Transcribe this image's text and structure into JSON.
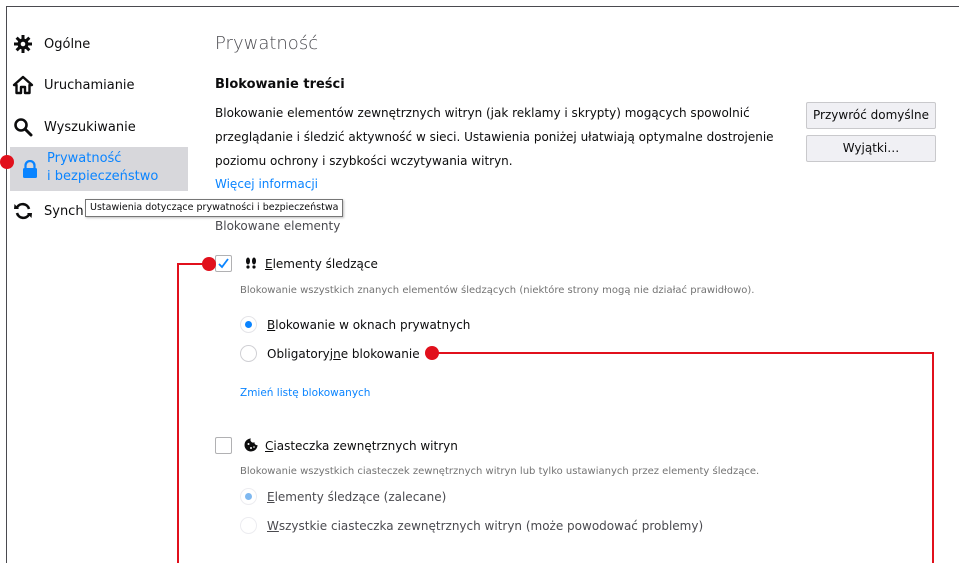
{
  "sidebar": {
    "items": [
      {
        "label": "Ogólne",
        "icon": "gear-icon"
      },
      {
        "label": "Uruchamianie",
        "icon": "home-icon"
      },
      {
        "label": "Wyszukiwanie",
        "icon": "search-icon"
      },
      {
        "label_line1": "Prywatność",
        "label_line2": "i bezpieczeństwo",
        "icon": "lock-icon",
        "active": true
      },
      {
        "label": "Synch",
        "icon": "sync-icon"
      }
    ],
    "tooltip": "Ustawienia dotyczące prywatności i bezpieczeństwa"
  },
  "main": {
    "title": "Prywatność",
    "section_title": "Blokowanie treści",
    "description_1": "Blokowanie elementów zewnętrznych witryn (jak reklamy i skrypty) mogących spowolnić",
    "description_2": "przeglądanie i śledzić aktywność w sieci. Ustawienia poniżej ułatwiają optymalne dostrojenie",
    "description_3": "poziomu ochrony i szybkości wczytywania witryn.",
    "more_info_link": "Więcej informacji",
    "restore_defaults_button": "Przywróć domyślne",
    "exceptions_button": "Wyjątki…",
    "blocked_heading": "Blokowane elementy",
    "trackers": {
      "checked": true,
      "label_prefix": "E",
      "label_rest": "lementy śledzące",
      "description": "Blokowanie wszystkich znanych elementów śledzących (niektóre strony mogą nie działać prawidłowo).",
      "options": [
        {
          "prefix": "B",
          "rest": "lokowanie w oknach prywatnych",
          "selected": true
        },
        {
          "before": "Obligatoryj",
          "u": "n",
          "after": "e blokowanie",
          "selected": false
        }
      ],
      "change_list_link": "Zmień listę blokowanych"
    },
    "cookies": {
      "checked": false,
      "label_prefix": "C",
      "label_rest": "iasteczka zewnętrznych witryn",
      "description": "Blokowanie wszystkich ciasteczek zewnętrznych witryn lub tylko ustawianych przez elementy śledzące.",
      "options": [
        {
          "prefix": "E",
          "rest": "lementy śledzące (zalecane)",
          "selected": true
        },
        {
          "prefix": "W",
          "rest": "szystkie ciasteczka zewnętrznych witryn (może powodować problemy)",
          "selected": false
        }
      ]
    }
  },
  "colors": {
    "accent": "#0a84ff",
    "callout": "#e1101c",
    "active_bg": "#d7d7db"
  }
}
